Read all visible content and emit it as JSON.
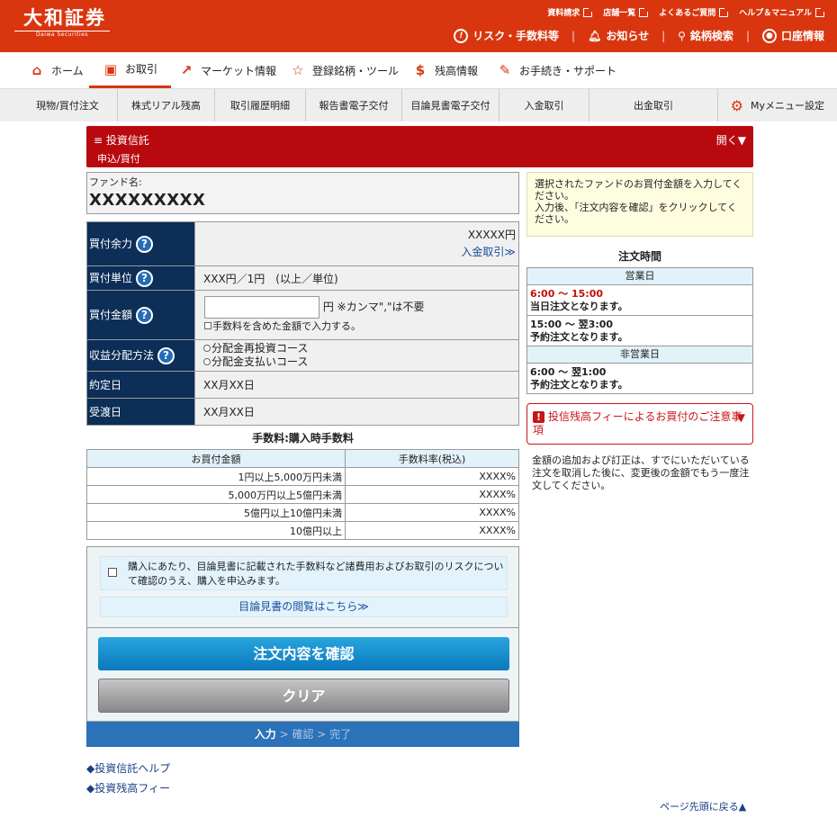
{
  "header": {
    "logo_ja": "大和証券",
    "logo_en": "Daiwa Securities",
    "top_links": [
      "資料請求",
      "店舗一覧",
      "よくあるご質問",
      "ヘルプ＆マニュアル"
    ],
    "tools": {
      "risk": "リスク・手数料等",
      "notice": "お知らせ",
      "search": "銘柄検索",
      "account": "口座情報"
    },
    "brand_color": "#d9360f"
  },
  "nav_main": [
    "ホーム",
    "お取引",
    "マーケット情報",
    "登録銘柄・ツール",
    "残高情報",
    "お手続き・サポート"
  ],
  "nav_sub": [
    "現物/買付注文",
    "株式リアル残高",
    "取引履歴明細",
    "報告書電子交付",
    "目論見書電子交付",
    "入金取引",
    "出金取引"
  ],
  "my_menu": "Myメニュー設定",
  "band": {
    "title": "投資信託",
    "sub": "申込/買付",
    "open": "開く▼"
  },
  "fund": {
    "label": "ファンド名:",
    "name": "XXXXXXXXX"
  },
  "form": {
    "capacity_label": "買付余力",
    "capacity_value": "XXXXX円",
    "deposit_link": "入金取引≫",
    "unit_label": "買付単位",
    "unit_value": "XXX円／1円　(以上／単位)",
    "amount_label": "買付金額",
    "amount_suffix": "円 ※カンマ\",\"は不要",
    "amount_check": "手数料を含めた金額で入力する。",
    "dist_label": "収益分配方法",
    "dist_opt1": "分配金再投資コース",
    "dist_opt2": "分配金支払いコース",
    "contract_label": "約定日",
    "contract_value": "XX月XX日",
    "delivery_label": "受渡日",
    "delivery_value": "XX月XX日"
  },
  "fee": {
    "caption": "手数料:購入時手数料",
    "headers": [
      "お買付金額",
      "手数料率(税込)"
    ],
    "rows": [
      [
        "1円以上5,000万円未満",
        "XXXX%"
      ],
      [
        "5,000万円以上5億円未満",
        "XXXX%"
      ],
      [
        "5億円以上10億円未満",
        "XXXX%"
      ],
      [
        "10億円以上",
        "XXXX%"
      ]
    ]
  },
  "agree": {
    "text": "購入にあたり、目論見書に記載された手数料など諸費用およびお取引のリスクについて確認のうえ、購入を申込みます。",
    "prospectus_link": "目論見書の閲覧はこちら≫"
  },
  "buttons": {
    "confirm": "注文内容を確認",
    "clear": "クリア"
  },
  "steps": {
    "current": "入力",
    "rest": " > 確認 > 完了"
  },
  "links": [
    "◆投資信託ヘルプ",
    "◆投資残高フィー"
  ],
  "page_top": "ページ先頭に戻る▲",
  "side": {
    "notice": "選択されたファンドのお買付金額を入力してください。\n入力後、「注文内容を確認」をクリックしてください。",
    "time_title": "注文時間",
    "business_day": "営業日",
    "bd1_time": "6:00 ～ 15:00",
    "bd1_note": "当日注文となります。",
    "bd2_time": "15:00 ～ 翌3:00",
    "bd2_note": "予約注文となります。",
    "non_business_day": "非営業日",
    "nb_time": "6:00 ～ 翌1:00",
    "nb_note": "予約注文となります。",
    "warn_title": "投信残高フィーによるお買付のご注意事項",
    "warn_text": "金額の追加および訂正は、すでにいただいている注文を取消した後に、変更後の金額でもう一度注文してください。"
  }
}
